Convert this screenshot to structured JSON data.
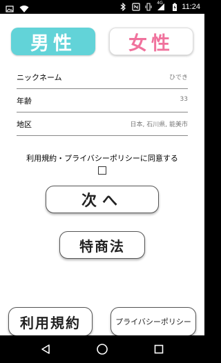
{
  "status_bar": {
    "time": "11:24",
    "left_icons": [
      "image-icon",
      "wifi-icon"
    ],
    "right_icons": [
      "bluetooth-icon",
      "nfc-icon",
      "vibrate-icon",
      "signal-icon",
      "battery-charging-icon"
    ],
    "network_label": "4G"
  },
  "gender": {
    "male_label": "男性",
    "female_label": "女性",
    "male_color": "#62d3d8",
    "female_color": "#f0729d",
    "selected": "male"
  },
  "form": {
    "rows": [
      {
        "label": "ニックネーム",
        "value": "ひでき"
      },
      {
        "label": "年齢",
        "value": "33"
      },
      {
        "label": "地区",
        "value": "日本, 石川県, 能美市"
      }
    ]
  },
  "agreement": {
    "text": "利用規約・プライバシーポリシーに同意する",
    "checked": false
  },
  "buttons": {
    "next_label": "次へ",
    "law_label": "特商法",
    "terms_label": "利用規約",
    "privacy_label": "プライバシーポリシー"
  },
  "nav_bar": {
    "icons": [
      "back-icon",
      "home-icon",
      "recent-apps-icon"
    ]
  }
}
